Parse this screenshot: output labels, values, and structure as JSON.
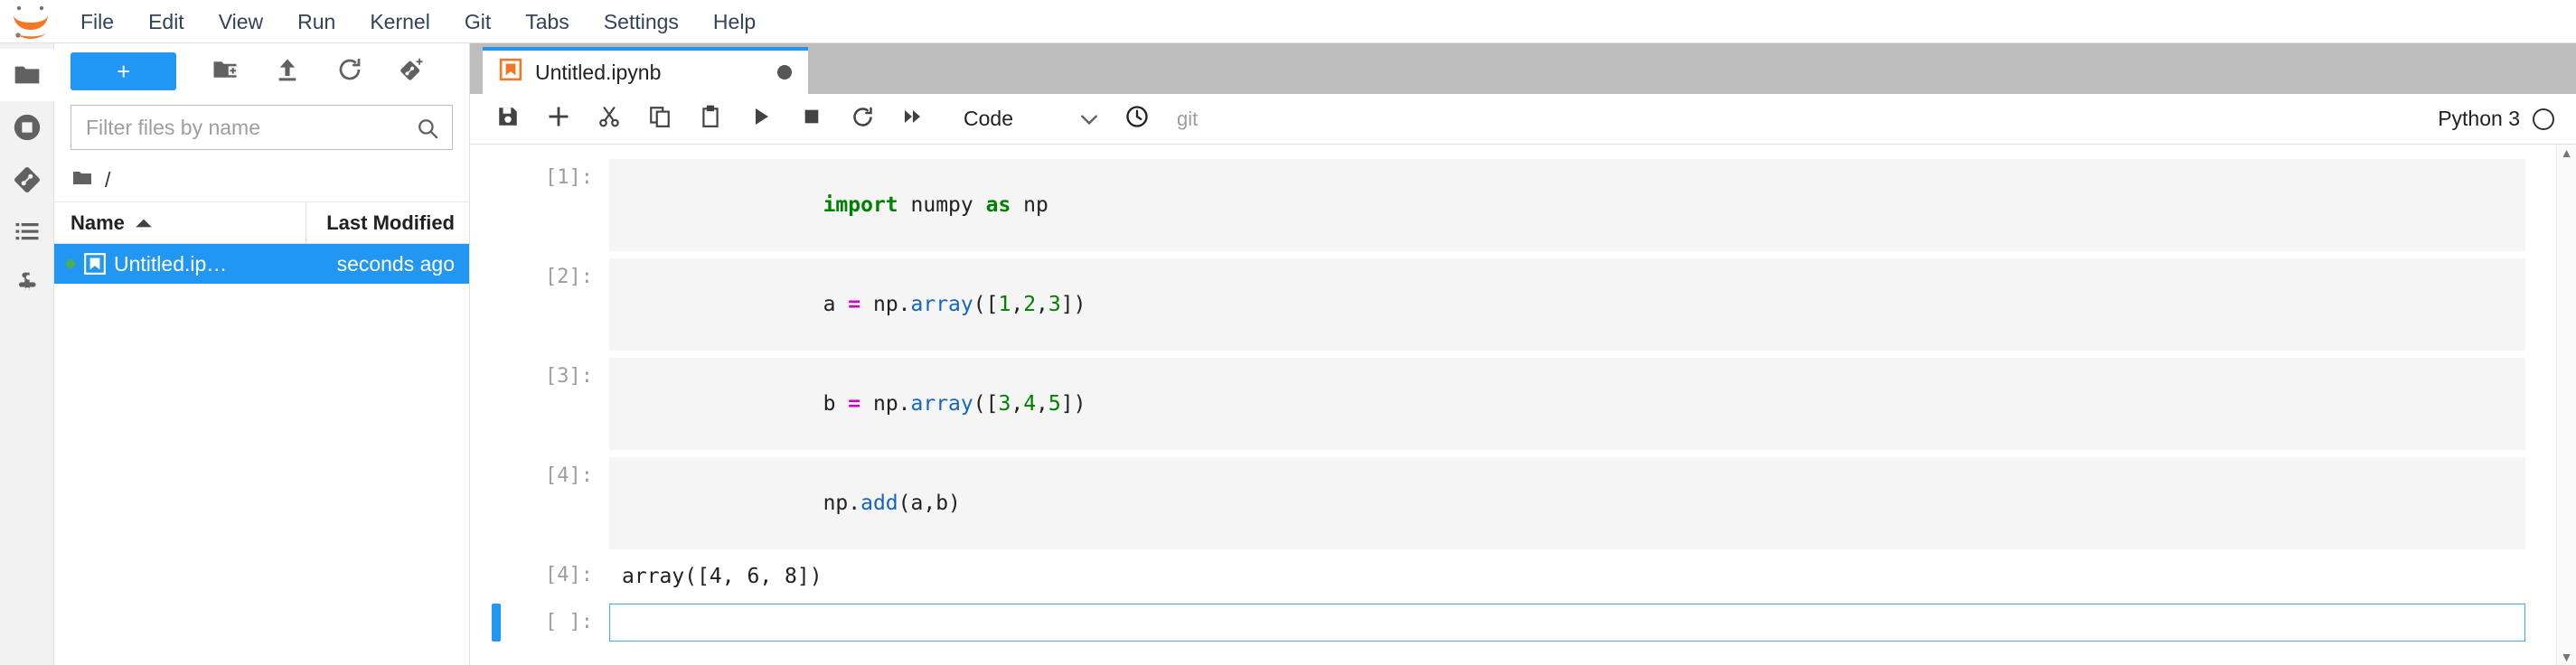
{
  "menubar": {
    "logo": "jupyter-logo",
    "items": [
      {
        "label": "File"
      },
      {
        "label": "Edit"
      },
      {
        "label": "View"
      },
      {
        "label": "Run"
      },
      {
        "label": "Kernel"
      },
      {
        "label": "Git"
      },
      {
        "label": "Tabs"
      },
      {
        "label": "Settings"
      },
      {
        "label": "Help"
      }
    ]
  },
  "activitybar": {
    "items": [
      {
        "icon": "folder-icon",
        "name": "file-browser",
        "active": true
      },
      {
        "icon": "running-kernels-icon",
        "name": "running-terminals-kernels",
        "active": false
      },
      {
        "icon": "git-icon",
        "name": "git-panel",
        "active": false
      },
      {
        "icon": "commands-list-icon",
        "name": "table-of-contents",
        "active": false
      },
      {
        "icon": "extensions-puzzle-icon",
        "name": "extension-manager",
        "active": false
      }
    ]
  },
  "filebrowser": {
    "new_launcher_label": "+",
    "toolbar_icons": [
      {
        "name": "new-folder-icon"
      },
      {
        "name": "upload-icon"
      },
      {
        "name": "refresh-icon"
      },
      {
        "name": "git-clone-icon"
      }
    ],
    "filter": {
      "placeholder": "Filter files by name",
      "value": "",
      "icon": "search-icon"
    },
    "breadcrumb": {
      "root_icon": "folder-icon",
      "path": "/"
    },
    "columns": {
      "name": "Name",
      "last_modified": "Last Modified",
      "sort_icon": "sort-ascending-icon"
    },
    "rows": [
      {
        "icon": "notebook-icon",
        "running_dot": true,
        "name": "Untitled.ip…",
        "last_modified": "seconds ago",
        "selected": true
      }
    ]
  },
  "dock": {
    "tabs": [
      {
        "icon": "notebook-icon",
        "label": "Untitled.ipynb",
        "dirty": true,
        "active": true
      }
    ]
  },
  "notebook_toolbar": {
    "buttons": [
      {
        "name": "save-button",
        "icon": "save-floppy-icon"
      },
      {
        "name": "insert-cell-button",
        "icon": "plus-icon"
      },
      {
        "name": "cut-cells-button",
        "icon": "scissors-icon"
      },
      {
        "name": "copy-cells-button",
        "icon": "copy-icon"
      },
      {
        "name": "paste-cells-button",
        "icon": "clipboard-paste-icon"
      },
      {
        "name": "run-cell-button",
        "icon": "play-icon"
      },
      {
        "name": "interrupt-kernel-button",
        "icon": "stop-square-icon"
      },
      {
        "name": "restart-kernel-button",
        "icon": "restart-circular-arrow-icon"
      },
      {
        "name": "restart-run-all-button",
        "icon": "fast-forward-icon"
      }
    ],
    "cell_type": {
      "value": "Code",
      "chevron": "chevron-down-icon"
    },
    "history_icon": "clock-icon",
    "git_label": "git",
    "kernel_name": "Python 3",
    "kernel_status_icon": "kernel-idle-circle-icon"
  },
  "cells": [
    {
      "kind": "code",
      "prompt": "[1]:",
      "active": false,
      "tokens": [
        {
          "t": "import",
          "c": "kw"
        },
        {
          "t": " numpy ",
          "c": "pl"
        },
        {
          "t": "as",
          "c": "kw"
        },
        {
          "t": " np",
          "c": "pl"
        }
      ],
      "plain": "import numpy as np"
    },
    {
      "kind": "code",
      "prompt": "[2]:",
      "active": false,
      "tokens": [
        {
          "t": "a ",
          "c": "pl"
        },
        {
          "t": "=",
          "c": "op"
        },
        {
          "t": " np.",
          "c": "pl"
        },
        {
          "t": "array",
          "c": "fn"
        },
        {
          "t": "([",
          "c": "pl"
        },
        {
          "t": "1",
          "c": "num"
        },
        {
          "t": ",",
          "c": "pl"
        },
        {
          "t": "2",
          "c": "num"
        },
        {
          "t": ",",
          "c": "pl"
        },
        {
          "t": "3",
          "c": "num"
        },
        {
          "t": "])",
          "c": "pl"
        }
      ],
      "plain": "a = np.array([1,2,3])"
    },
    {
      "kind": "code",
      "prompt": "[3]:",
      "active": false,
      "tokens": [
        {
          "t": "b ",
          "c": "pl"
        },
        {
          "t": "=",
          "c": "op"
        },
        {
          "t": " np.",
          "c": "pl"
        },
        {
          "t": "array",
          "c": "fn"
        },
        {
          "t": "([",
          "c": "pl"
        },
        {
          "t": "3",
          "c": "num"
        },
        {
          "t": ",",
          "c": "pl"
        },
        {
          "t": "4",
          "c": "num"
        },
        {
          "t": ",",
          "c": "pl"
        },
        {
          "t": "5",
          "c": "num"
        },
        {
          "t": "])",
          "c": "pl"
        }
      ],
      "plain": "b = np.array([3,4,5])"
    },
    {
      "kind": "code",
      "prompt": "[4]:",
      "active": false,
      "tokens": [
        {
          "t": "np.",
          "c": "pl"
        },
        {
          "t": "add",
          "c": "fn"
        },
        {
          "t": "(a,b)",
          "c": "pl"
        }
      ],
      "plain": "np.add(a,b)"
    },
    {
      "kind": "output",
      "prompt": "[4]:",
      "active": false,
      "text": "array([4, 6, 8])"
    },
    {
      "kind": "code",
      "prompt": "[ ]:",
      "active": true,
      "tokens": [],
      "plain": ""
    }
  ],
  "scrollbar": {
    "up_arrow": "▲",
    "down_arrow": "▼"
  },
  "colors": {
    "accent_blue": "#2196f3",
    "tabbar_gray": "#bdbdbd",
    "cell_gray": "#f5f5f5",
    "keyword_green": "#008000",
    "operator_magenta": "#cc00cc",
    "function_blue": "#1565c0",
    "logo_orange": "#f37726"
  }
}
